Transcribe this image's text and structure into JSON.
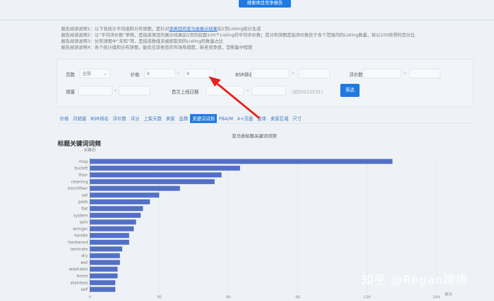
{
  "top_button": "搜索类目竞争报告",
  "notes": {
    "n1_pre": "报告阅读说明1：以下各统计平均值和分布饼图，是针对",
    "n1_link": "该类目的亚马逊展示结果",
    "n1_post": "前2页Listing统计生成",
    "n2": "报告阅读说明2：以“平均评价数”举例，是指该类目的展示结果前2页的前面100个Listing的平均评价数；其分布饼图是指评价数处于各个范围内的Listing数量，除以100所得的百分比",
    "n3": "报告阅读说明3：分布饼图中“未知”项，是指该数值未被抓取到的Listing的数量占比",
    "n4": "报告阅读说明4：各个统计值和分布饼图，能反应该类目的市场热销度，新老竞争度，垄断集中程度"
  },
  "filter": {
    "pages_label": "页数",
    "pages_value": "全部",
    "price_label": "价格",
    "dollar": "$",
    "dash": "-",
    "bsr_label": "BSR排名",
    "reviews_label": "评价数",
    "sales_label": "销量",
    "date_label": "首次上线日期",
    "date_hint": "(如20210531)",
    "submit": "筛选"
  },
  "tabs": [
    "价格",
    "月销量",
    "BSR排名",
    "评价数",
    "评分",
    "上架天数",
    "卖家",
    "品牌",
    "关键词词频",
    "FBA/M",
    "A+页面",
    "变体",
    "卖家区域",
    "尺寸"
  ],
  "section_title": "标题关键词词频",
  "watermark": "知乎 @Regan跨境",
  "chart_data": {
    "type": "bar",
    "orientation": "horizontal",
    "title": "亚马逊标题关键词词频",
    "ylabel": "关键词",
    "xlabel": "频次",
    "categories": [
      "mop",
      "bucket",
      "floor",
      "cleaning",
      "microfiber",
      "set",
      "pads",
      "flat",
      "system",
      "spin",
      "wringer",
      "handle",
      "hardwood",
      "laminate",
      "dry",
      "wet",
      "washable",
      "home",
      "stainless",
      "self"
    ],
    "values": [
      131,
      65,
      57,
      54,
      39,
      30,
      26,
      23,
      22,
      20,
      19,
      17,
      17,
      14,
      13,
      13,
      12,
      12,
      11,
      11
    ],
    "xlim": [
      0,
      150
    ],
    "xticks": [
      "0",
      "30",
      "60",
      "90",
      "120",
      "150"
    ],
    "color": "#5470c6"
  }
}
